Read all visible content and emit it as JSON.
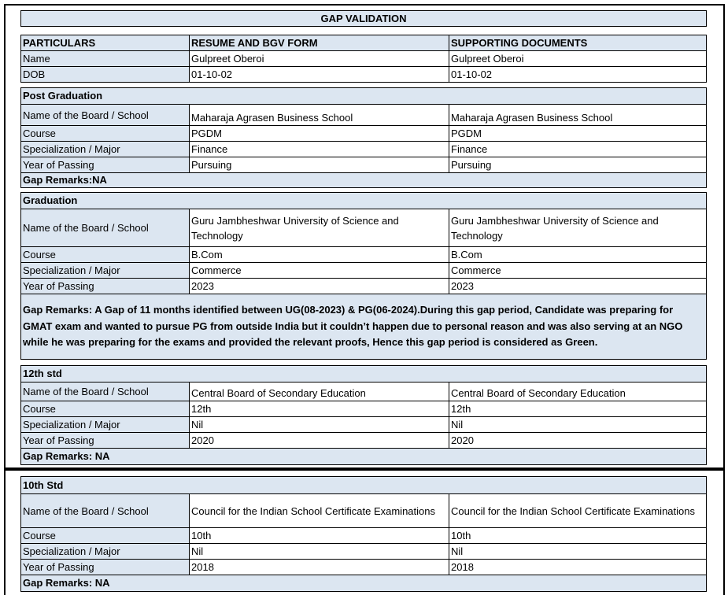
{
  "title": "GAP VALIDATION",
  "header": {
    "col1": "PARTICULARS",
    "col2": "RESUME AND BGV FORM",
    "col3": "SUPPORTING DOCUMENTS"
  },
  "personal": [
    {
      "label": "Name",
      "resume": "Gulpreet Oberoi",
      "docs": "Gulpreet Oberoi"
    },
    {
      "label": "DOB",
      "resume": "01-10-02",
      "docs": "01-10-02"
    }
  ],
  "sections": [
    {
      "heading": "Post Graduation",
      "rows": [
        {
          "label": "Name of the Board / School",
          "resume": "Maharaja Agrasen Business School",
          "docs": "Maharaja Agrasen Business School"
        },
        {
          "label": "Course",
          "resume": "PGDM",
          "docs": "PGDM"
        },
        {
          "label": "Specialization / Major",
          "resume": "Finance",
          "docs": "Finance"
        },
        {
          "label": "Year of Passing",
          "resume": "Pursuing",
          "docs": "Pursuing"
        }
      ],
      "remarks": "Gap Remarks:NA"
    },
    {
      "heading": "Graduation",
      "rows": [
        {
          "label": "Name of the Board / School",
          "resume": "Guru Jambheshwar University of Science and Technology",
          "docs": "Guru Jambheshwar University of Science and Technology"
        },
        {
          "label": "Course",
          "resume": "B.Com",
          "docs": "B.Com"
        },
        {
          "label": "Specialization / Major",
          "resume": "Commerce",
          "docs": "Commerce"
        },
        {
          "label": "Year of Passing",
          "resume": "2023",
          "docs": "2023"
        }
      ],
      "remarks": "Gap Remarks: A Gap of 11 months identified between UG(08-2023) & PG(06-2024).During this gap period, Candidate was preparing for GMAT exam and wanted to pursue PG from outside India but it couldn’t happen due to personal reason and was also serving at an NGO while he was preparing for the exams and provided the relevant proofs, Hence this gap period is considered as Green."
    },
    {
      "heading": "12th std",
      "rows": [
        {
          "label": "Name of the Board / School",
          "resume": "Central Board of Secondary Education",
          "docs": "Central Board of Secondary Education"
        },
        {
          "label": "Course",
          "resume": "12th",
          "docs": "12th"
        },
        {
          "label": "Specialization / Major",
          "resume": "Nil",
          "docs": "Nil"
        },
        {
          "label": "Year of Passing",
          "resume": "2020",
          "docs": "2020"
        }
      ],
      "remarks": "Gap Remarks: NA"
    },
    {
      "heading": "10th Std",
      "rows": [
        {
          "label": "Name of the Board / School",
          "resume": "Council for the Indian School Certificate Examinations",
          "docs": "Council for the Indian School Certificate Examinations"
        },
        {
          "label": "Course",
          "resume": "10th",
          "docs": "10th"
        },
        {
          "label": "Specialization / Major",
          "resume": "Nil",
          "docs": "Nil"
        },
        {
          "label": "Year of Passing",
          "resume": "2018",
          "docs": "2018"
        }
      ],
      "remarks": "Gap Remarks: NA"
    }
  ]
}
